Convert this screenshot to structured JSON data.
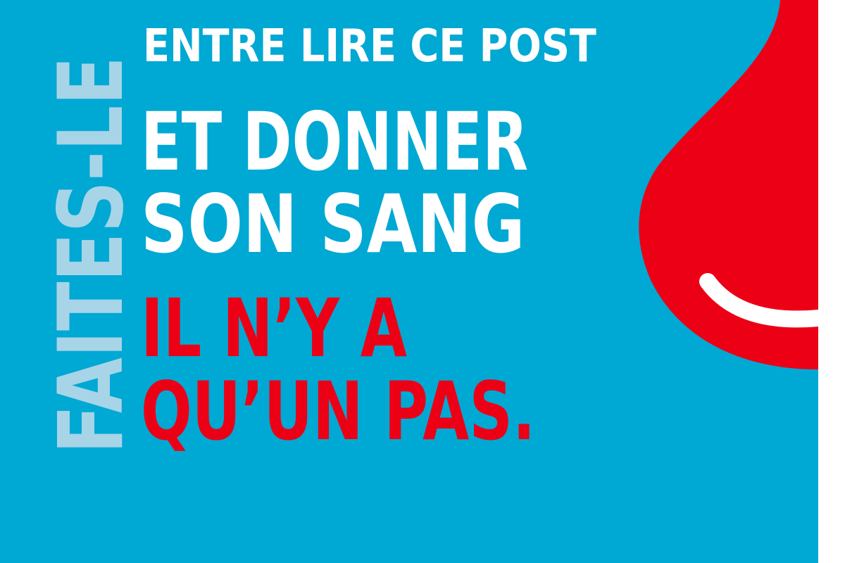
{
  "poster": {
    "vertical_text": "FAITES-LE",
    "line1": "ENTRE LIRE CE POST",
    "line2": "ET DONNER",
    "line3": "SON SANG",
    "line4": "IL N’Y A",
    "line5": "QU’UN PAS."
  },
  "icons": {
    "drop": "blood-drop-smile-icon"
  },
  "colors": {
    "background": "#00a8d4",
    "vertical_text": "#a8d4e8",
    "white_text": "#ffffff",
    "red_text": "#ec0016",
    "drop": "#ec0016",
    "right_strip": "#ffffff"
  }
}
